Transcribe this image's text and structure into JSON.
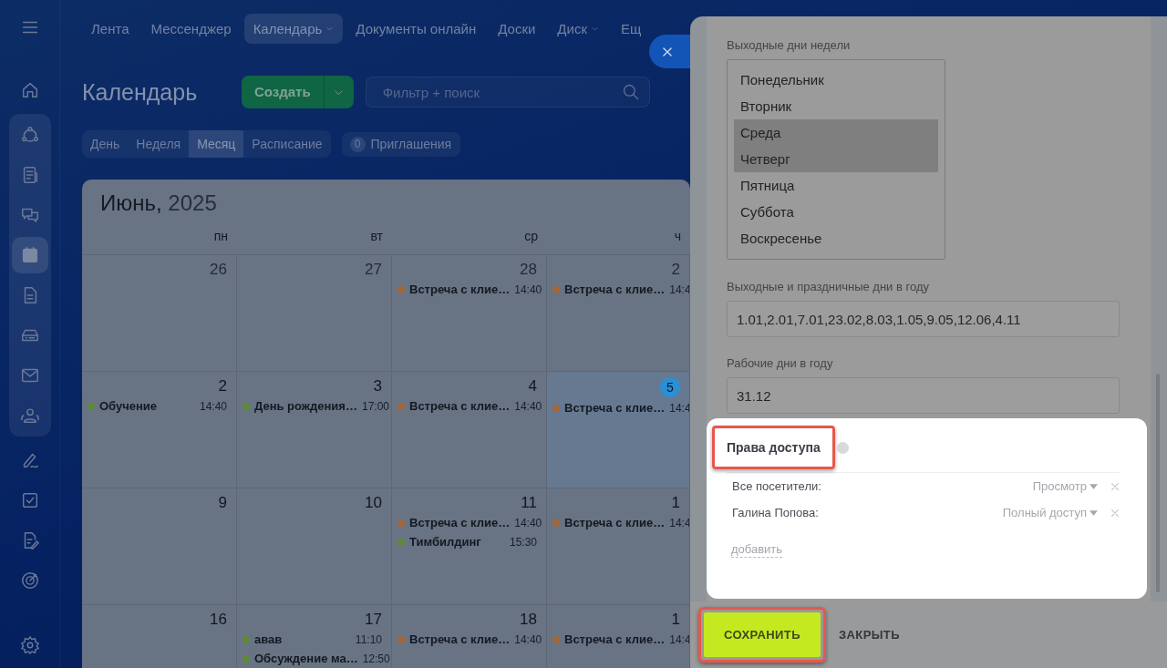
{
  "sidebar": {
    "sections": [
      {
        "grouped": false,
        "items": [
          {
            "kind": "home",
            "selected": false
          }
        ]
      },
      {
        "grouped": true,
        "items": [
          {
            "kind": "network",
            "selected": false
          },
          {
            "kind": "news",
            "selected": false
          },
          {
            "kind": "chat",
            "selected": false
          },
          {
            "kind": "calendar",
            "selected": true
          },
          {
            "kind": "document",
            "selected": false
          },
          {
            "kind": "drive",
            "selected": false
          },
          {
            "kind": "mail",
            "selected": false
          },
          {
            "kind": "people",
            "selected": false
          }
        ]
      },
      {
        "grouped": false,
        "items": [
          {
            "kind": "pen",
            "selected": false
          },
          {
            "kind": "checkbox",
            "selected": false
          },
          {
            "kind": "document-edit",
            "selected": false
          },
          {
            "kind": "target",
            "selected": false
          }
        ]
      }
    ]
  },
  "top_nav": [
    {
      "label": "Лента",
      "selected": false,
      "dropdown": false
    },
    {
      "label": "Мессенджер",
      "selected": false,
      "dropdown": false
    },
    {
      "label": "Календарь",
      "selected": true,
      "dropdown": true
    },
    {
      "label": "Документы онлайн",
      "selected": false,
      "dropdown": false
    },
    {
      "label": "Доски",
      "selected": false,
      "dropdown": false
    },
    {
      "label": "Диск",
      "selected": false,
      "dropdown": true
    },
    {
      "label": "Ещ",
      "selected": false,
      "dropdown": false
    }
  ],
  "header": {
    "title": "Календарь",
    "create_button": "Создать",
    "search": {
      "placeholder": "Фильтр + поиск"
    }
  },
  "view_tabs": [
    {
      "label": "День",
      "selected": false
    },
    {
      "label": "Неделя",
      "selected": false
    },
    {
      "label": "Месяц",
      "selected": true
    },
    {
      "label": "Расписание",
      "selected": false
    }
  ],
  "invitations": {
    "count": "0",
    "label": "Приглашения"
  },
  "calendar": {
    "month": "Июнь,",
    "year": "2025",
    "weekdays": [
      "пн",
      "вт",
      "ср",
      "ч"
    ],
    "weeks": [
      [
        {
          "day": "26",
          "other_month": true,
          "today": false
        },
        {
          "day": "27",
          "other_month": true,
          "today": false
        },
        {
          "day": "28",
          "other_month": true,
          "today": false,
          "events": [
            {
              "title": "Встреча с клие…",
              "time": "14:40",
              "color": "#a0683a"
            }
          ]
        },
        {
          "day": "2",
          "other_month": true,
          "today": false,
          "events": [
            {
              "title": "Встреча с клие…",
              "time": "14:4",
              "color": "#a0683a"
            }
          ]
        }
      ],
      [
        {
          "day": "2",
          "other_month": false,
          "today": false,
          "events": [
            {
              "title": "Обучение",
              "time": "14:40",
              "color": "#5c8a38"
            }
          ]
        },
        {
          "day": "3",
          "other_month": false,
          "today": false,
          "events": [
            {
              "title": "День рождения…",
              "time": "17:00",
              "color": "#5c8a38"
            }
          ]
        },
        {
          "day": "4",
          "other_month": false,
          "today": false,
          "events": [
            {
              "title": "Встреча с клие…",
              "time": "14:40",
              "color": "#a0683a"
            }
          ]
        },
        {
          "day": "5",
          "other_month": false,
          "today": true,
          "events": [
            {
              "title": "Встреча с клие…",
              "time": "14:4",
              "color": "#a0683a"
            }
          ]
        }
      ],
      [
        {
          "day": "9",
          "other_month": false,
          "today": false
        },
        {
          "day": "10",
          "other_month": false,
          "today": false
        },
        {
          "day": "11",
          "other_month": false,
          "today": false,
          "events": [
            {
              "title": "Встреча с клие…",
              "time": "14:40",
              "color": "#a0683a"
            },
            {
              "title": "Тимбилдинг",
              "time": "15:30",
              "color": "#5c8a38"
            }
          ]
        },
        {
          "day": "1",
          "other_month": false,
          "today": false,
          "events": [
            {
              "title": "Встреча с клие…",
              "time": "14:4",
              "color": "#a0683a"
            }
          ]
        }
      ],
      [
        {
          "day": "16",
          "other_month": false,
          "today": false
        },
        {
          "day": "17",
          "other_month": false,
          "today": false,
          "events": [
            {
              "title": "авав",
              "time": "11:10",
              "color": "#5c8a38"
            },
            {
              "title": "Обсуждение ма…",
              "time": "12:50",
              "color": "#5c8a38"
            }
          ]
        },
        {
          "day": "18",
          "other_month": false,
          "today": false,
          "events": [
            {
              "title": "Встреча с клие…",
              "time": "14:40",
              "color": "#a0683a"
            }
          ]
        },
        {
          "day": "1",
          "other_month": false,
          "today": false,
          "events": [
            {
              "title": "Встреча с клие…",
              "time": "14:4",
              "color": "#a0683a"
            }
          ]
        }
      ]
    ]
  },
  "settings_panel": {
    "weekend_days": {
      "label": "Выходные дни недели",
      "options": [
        {
          "label": "Понедельник",
          "selected": false
        },
        {
          "label": "Вторник",
          "selected": false
        },
        {
          "label": "Среда",
          "selected": true
        },
        {
          "label": "Четверг",
          "selected": true
        },
        {
          "label": "Пятница",
          "selected": false
        },
        {
          "label": "Суббота",
          "selected": false
        },
        {
          "label": "Воскресенье",
          "selected": false
        }
      ]
    },
    "holidays": {
      "label": "Выходные и праздничные дни в году",
      "value": "1.01,2.01,7.01,23.02,8.03,1.05,9.05,12.06,4.11"
    },
    "workdays": {
      "label": "Рабочие дни в году",
      "value": "31.12"
    },
    "access": {
      "title": "Права доступа",
      "highlighted": true,
      "rows": [
        {
          "name": "Все посетители:",
          "permission": "Просмотр"
        },
        {
          "name": "Галина Попова:",
          "permission": "Полный доступ"
        }
      ],
      "add_link": "добавить"
    },
    "footer": {
      "buttons": [
        {
          "label": "СОХРАНИТЬ",
          "kind": "primary",
          "highlighted": true
        },
        {
          "label": "ЗАКРЫТЬ",
          "kind": "link",
          "highlighted": false
        }
      ]
    }
  }
}
